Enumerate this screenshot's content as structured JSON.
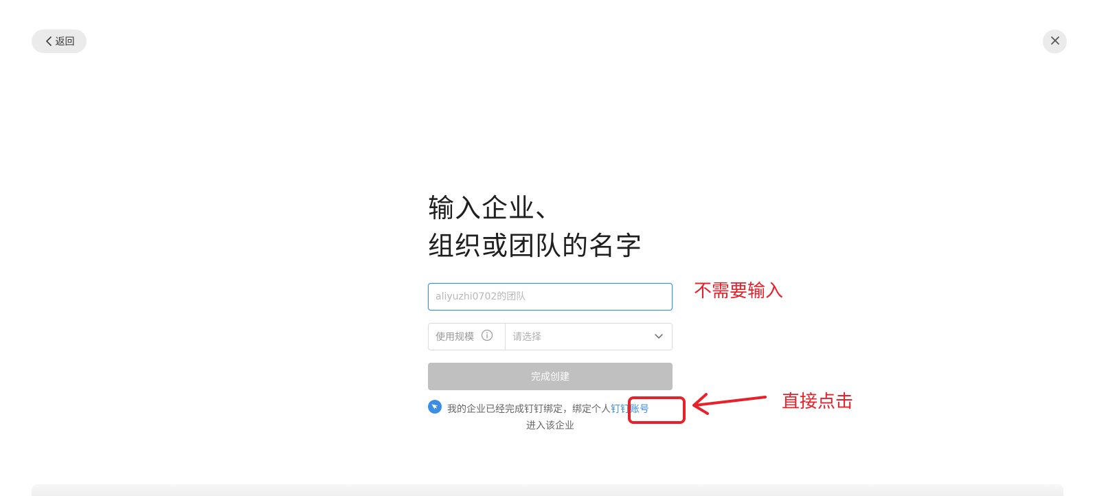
{
  "header": {
    "back_label": "返回",
    "back_icon": "chevron-left-icon",
    "close_icon": "close-icon"
  },
  "form": {
    "title_line1": "输入企业、",
    "title_line2": "组织或团队的名字",
    "name_input": {
      "placeholder": "aliyuzhi0702的团队",
      "value": ""
    },
    "scale": {
      "label": "使用规模",
      "info_icon": "info-icon",
      "select_placeholder": "请选择",
      "chevron_icon": "chevron-down-icon"
    },
    "submit_label": "完成创建",
    "bind_note": {
      "icon": "dingtalk-icon",
      "text_before": "我的企业已经完成钉钉绑定，绑定个人",
      "link_text": "钉钉账号",
      "text_after": "进入该企业"
    }
  },
  "annotations": {
    "no_input": "不需要输入",
    "click_directly": "直接点击",
    "color": "#e8202a"
  },
  "colors": {
    "accent": "#3a8ee6",
    "button_disabled": "#c0c0c0"
  }
}
